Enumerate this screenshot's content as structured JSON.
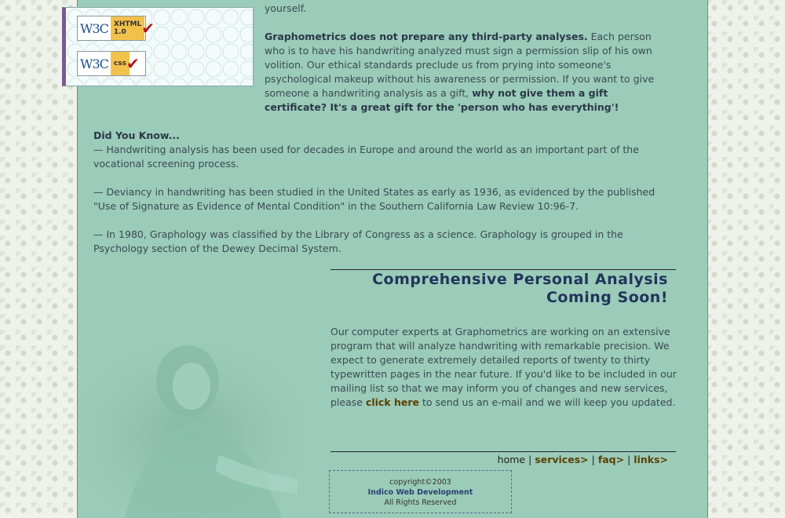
{
  "intro_tail": "yourself.",
  "third_party": {
    "lead": "Graphometrics does not prepare any third-party analyses.",
    "body": " Each person who is to have his handwriting analyzed must sign a permission slip of his own volition. Our ethical standards preclude us from prying into someone's psychological makeup without his awareness or permission. If you want to give someone a handwriting analysis as a gift, ",
    "tail": "why not give them a gift certificate? It's a great gift for the 'person who has everything'!"
  },
  "did_you_know": {
    "title": "Did You Know...",
    "facts": [
      "— Handwriting analysis has been used for decades in Europe and around the world as an important part of the vocational screening process.",
      "— Deviancy in handwriting has been studied in the United States as early as 1936, as evidenced by the published \"Use of Signature as Evidence of Mental Condition\" in the Southern California Law Review 10:96-7.",
      "— In 1980, Graphology was classified by the Library of Congress as a science. Graphology is grouped in the Psychology section of the Dewey Decimal System."
    ]
  },
  "badges": {
    "xhtml": {
      "logo": "W3C",
      "line1": "XHTML",
      "line2": "1.0"
    },
    "css": {
      "logo": "W3C",
      "line1": "css",
      "line2": ""
    }
  },
  "coming_soon": {
    "heading_line1": "Comprehensive Personal Analysis",
    "heading_line2": "Coming Soon!",
    "body_pre": "Our computer experts at Graphometrics are working on an extensive program that will analyze handwriting with remarkable precision. We expect to generate extremely detailed reports of twenty to thirty typewritten pages in the near future. If you'd like to be included in our mailing list so that we may inform you of changes and new services, please ",
    "link": "click here",
    "body_post": " to send us an e-mail and we will keep you updated."
  },
  "nav": {
    "home": "home",
    "services": "services>",
    "faq": "faq>",
    "links": "links>",
    "sep": "|"
  },
  "footer": {
    "copyright": "copyright©2003",
    "company": "Indico Web Development",
    "rights": "All Rights Reserved"
  },
  "colors": {
    "content_bg": "#9bcbb9",
    "heading": "#22355a",
    "link": "#5a4200"
  }
}
